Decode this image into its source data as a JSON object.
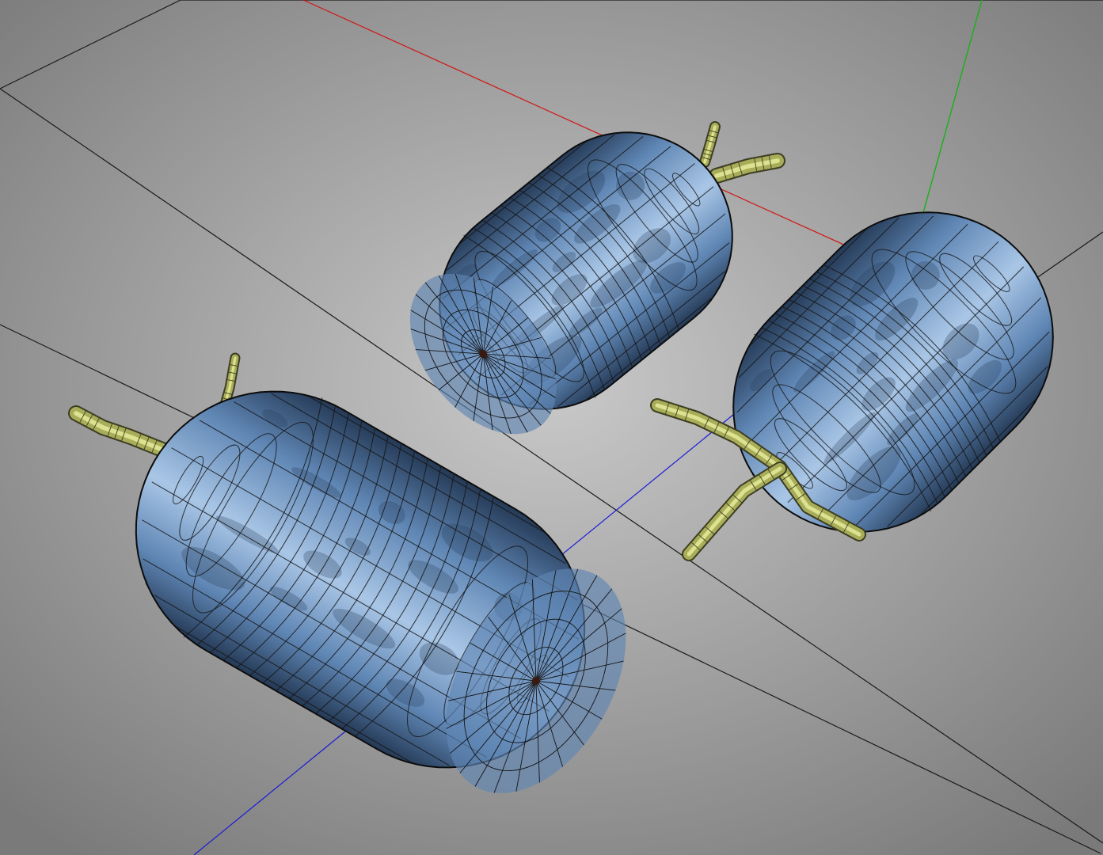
{
  "viewport": {
    "background_center": "#c9c9c9",
    "background_edge": "#7a7a7a",
    "grid_line_color": "#1a1a1a",
    "axis_x_color": "#d01818",
    "axis_y_color": "#19b019",
    "axis_z_color": "#1a1ad8",
    "mesh_wire_color": "#141414",
    "berry_skin_light": "#a9c6e6",
    "berry_skin_mid": "#5f86b4",
    "berry_skin_dark": "#243955",
    "stem_light": "#e9ef9c",
    "stem_mid": "#a8ad5a",
    "stem_dark": "#3d3d22"
  },
  "scene": {
    "objects": [
      {
        "name": "honeysuckle-berry-large",
        "kind": "mesh"
      },
      {
        "name": "honeysuckle-berry-back",
        "kind": "mesh"
      },
      {
        "name": "honeysuckle-berry-right",
        "kind": "mesh"
      }
    ]
  }
}
